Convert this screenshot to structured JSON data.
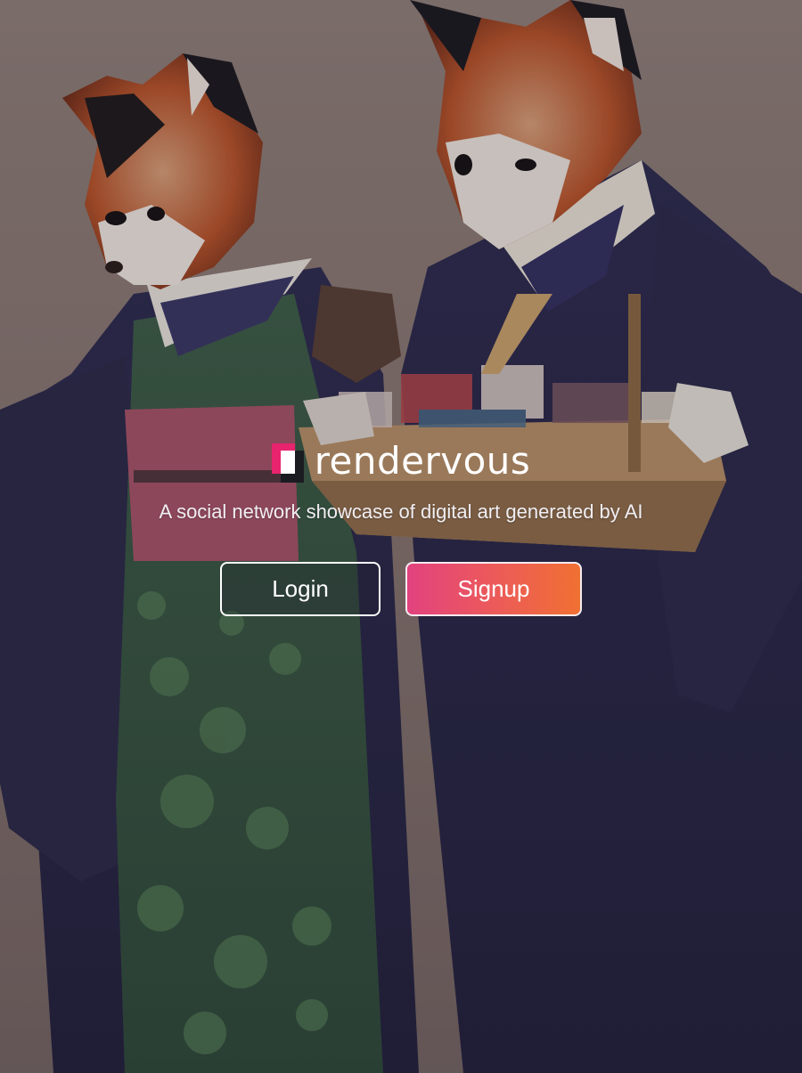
{
  "app": {
    "brand_name": "rendervous",
    "tagline": "A social network showcase of digital art generated by AI"
  },
  "background": {
    "description_icon": "fox-kimono-artwork-image"
  },
  "actions": {
    "login_label": "Login",
    "signup_label": "Signup"
  },
  "colors": {
    "signup_gradient_start": "#e2427f",
    "signup_gradient_end": "#f07032",
    "logo_pink": "#e8246e",
    "logo_dark": "#1b1b22",
    "text": "#ffffff"
  }
}
